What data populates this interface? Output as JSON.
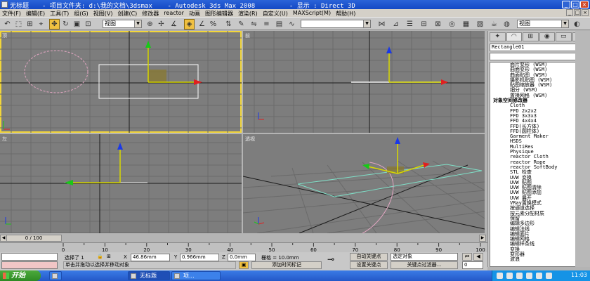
{
  "title_bar": {
    "doc_name": "无标题",
    "text": "- 项目文件夹: d:\\我的文档\\3dsmax    - Autodesk 3ds Max 2008         - 显示 : Direct 3D"
  },
  "menu": [
    "文件(F)",
    "编辑(E)",
    "工具(T)",
    "组(G)",
    "视图(V)",
    "创建(C)",
    "修改器",
    "reactor",
    "动画",
    "图形编辑器",
    "渲染(R)",
    "自定义(U)",
    "MAXScript(M)",
    "帮助(H)"
  ],
  "toolbar": {
    "view_dropdown": "视图",
    "named_selection": "",
    "right_view_dropdown": "视图"
  },
  "viewports": {
    "top": {
      "label": "顶"
    },
    "front": {
      "label": "前"
    },
    "left": {
      "label": "左"
    },
    "perspective": {
      "label": "透视"
    }
  },
  "command_panel": {
    "object_name": "Rectangle01",
    "modifier_list": "",
    "items": [
      {
        "label": "面片变形 (WSM)",
        "head": false
      },
      {
        "label": "曲面变形 (WSM)",
        "head": false
      },
      {
        "label": "曲面贴图 (WSM)",
        "head": false
      },
      {
        "label": "摄影机贴图 (WSM)",
        "head": false
      },
      {
        "label": "贴图缩放器 (WSM)",
        "head": false
      },
      {
        "label": "细分 (WSM)",
        "head": false
      },
      {
        "label": "置换网格 (WSM)",
        "head": false
      },
      {
        "label": "对象空间修改器",
        "head": true
      },
      {
        "label": "Cloth",
        "head": false
      },
      {
        "label": "FFD 2x2x2",
        "head": false
      },
      {
        "label": "FFD 3x3x3",
        "head": false
      },
      {
        "label": "FFD 4x4x4",
        "head": false
      },
      {
        "label": "FFD(长方体)",
        "head": false
      },
      {
        "label": "FFD(圆柱体)",
        "head": false
      },
      {
        "label": "Garment Maker",
        "head": false
      },
      {
        "label": "HSDS",
        "head": false
      },
      {
        "label": "MultiRes",
        "head": false
      },
      {
        "label": "Physique",
        "head": false
      },
      {
        "label": "reactor Cloth",
        "head": false
      },
      {
        "label": "reactor Rope",
        "head": false
      },
      {
        "label": "reactor SoftBody",
        "head": false
      },
      {
        "label": "STL 检查",
        "head": false
      },
      {
        "label": "UVW 变换",
        "head": false
      },
      {
        "label": "UVW 贴图",
        "head": false
      },
      {
        "label": "UVW 贴图清除",
        "head": false
      },
      {
        "label": "UVW 贴图添加",
        "head": false
      },
      {
        "label": "UVW 展开",
        "head": false
      },
      {
        "label": "VRay置换模式",
        "head": false
      },
      {
        "label": "按通道选择",
        "head": false
      },
      {
        "label": "按元素分配材质",
        "head": false
      },
      {
        "label": "保留",
        "head": false
      },
      {
        "label": "编辑多边形",
        "head": false
      },
      {
        "label": "编辑法线",
        "head": false
      },
      {
        "label": "编辑面片",
        "head": false
      },
      {
        "label": "编辑网格",
        "head": false
      },
      {
        "label": "编辑样条线",
        "head": false
      },
      {
        "label": "变换",
        "head": false
      },
      {
        "label": "变形器",
        "head": false
      },
      {
        "label": "波浪",
        "head": false
      }
    ]
  },
  "timeline": {
    "frame_display": "0 / 100",
    "ticks": [
      "0",
      "10",
      "20",
      "30",
      "40",
      "50",
      "60",
      "70",
      "80",
      "90",
      "100"
    ]
  },
  "status": {
    "selected": "选择了 1",
    "x_label": "X",
    "x_value": "46.86mm",
    "y_label": "Y",
    "y_value": "0.966mm",
    "z_label": "Z",
    "z_value": "0.0mm",
    "grid": "栅格 = 10.0mm",
    "auto_key": "自动关键点",
    "selection_set": "选定对象",
    "set_key": "设置关键点",
    "key_filters": "关键点过滤器...",
    "prompt": "单击并拖动以选择并移动对象",
    "add_time_tag": "添加时间标记",
    "frame_field": "0"
  },
  "taskbar": {
    "start_label": "开始",
    "tasks": [
      "无标题",
      "项...",
      "无标题 - ..."
    ],
    "clock": "11:03"
  }
}
